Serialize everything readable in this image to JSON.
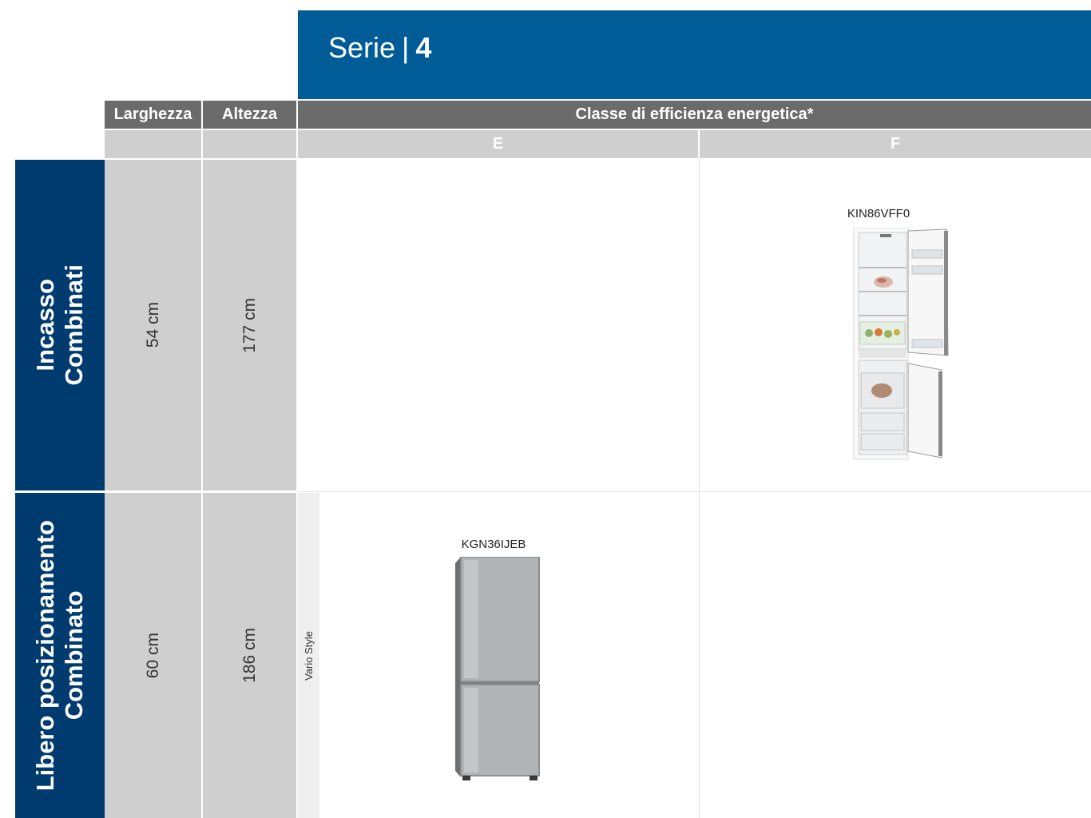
{
  "series": {
    "label": "Serie",
    "separator": "|",
    "number": "4"
  },
  "header": {
    "width": "Larghezza",
    "height": "Altezza",
    "energy_class": "Classe di efficienza energetica*",
    "class_e": "E",
    "class_f": "F"
  },
  "rows": [
    {
      "category": "Incasso\nCombinati",
      "width": "54 cm",
      "height": "177 cm",
      "class_f_product": {
        "model": "KIN86VFF0"
      }
    },
    {
      "category": "Libero posizionamento\nCombinato",
      "width": "60 cm",
      "height": "186 cm",
      "side_label": "Vario Style",
      "class_e_product": {
        "model": "KGN36IJEB"
      }
    }
  ],
  "colors": {
    "brand_blue": "#005c96",
    "category_navy": "#003b6f",
    "header_dark_grey": "#6b6b6b",
    "header_light_grey": "#cfcfcf"
  }
}
